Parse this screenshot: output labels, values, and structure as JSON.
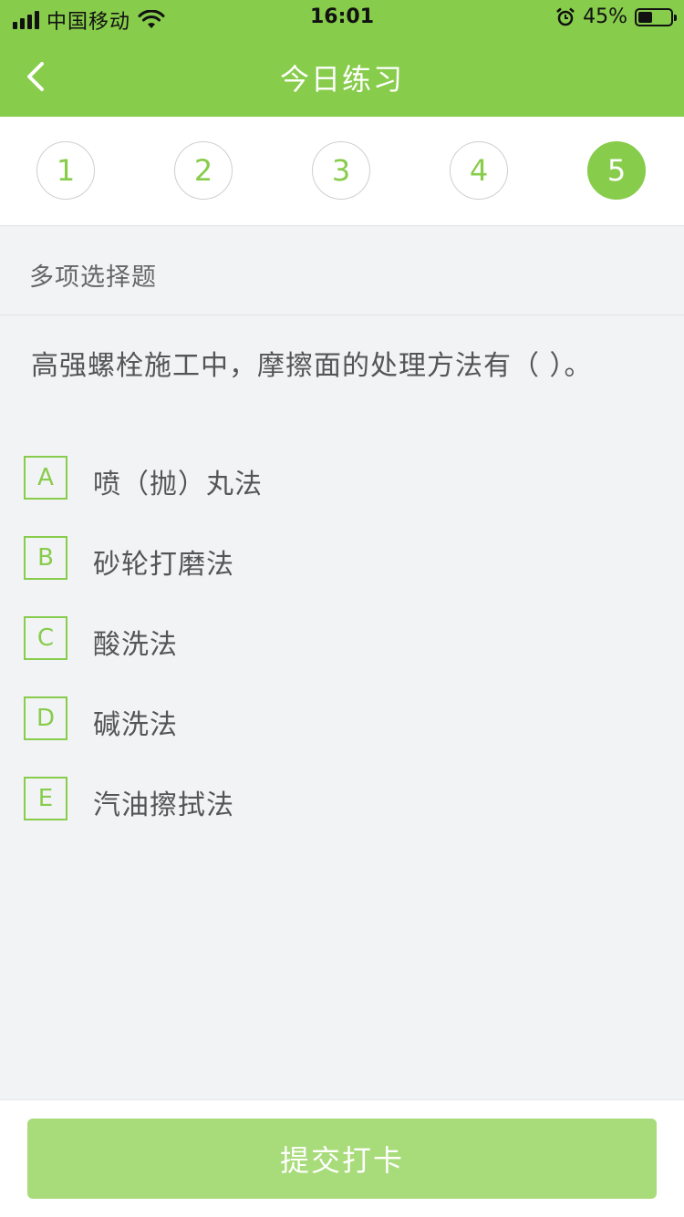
{
  "status_bar": {
    "carrier": "中国移动",
    "time": "16:01",
    "battery_percent": "45%",
    "battery_level": 0.45,
    "icons": [
      "signal-icon",
      "wifi-icon",
      "alarm-icon",
      "battery-icon"
    ]
  },
  "nav": {
    "title": "今日练习",
    "back_icon": "chevron-left-icon"
  },
  "steps": {
    "items": [
      "1",
      "2",
      "3",
      "4",
      "5"
    ],
    "active_index": 4
  },
  "question": {
    "type": "多项选择题",
    "text": "高强螺栓施工中，摩擦面的处理方法有（    ）。",
    "options": [
      {
        "letter": "A",
        "text": "喷（抛）丸法"
      },
      {
        "letter": "B",
        "text": "砂轮打磨法"
      },
      {
        "letter": "C",
        "text": "酸洗法"
      },
      {
        "letter": "D",
        "text": "碱洗法"
      },
      {
        "letter": "E",
        "text": "汽油擦拭法"
      }
    ]
  },
  "footer": {
    "submit_label": "提交打卡"
  },
  "colors": {
    "accent": "#87cc4b",
    "submit_disabled": "#a8db79",
    "background": "#f2f3f5"
  }
}
